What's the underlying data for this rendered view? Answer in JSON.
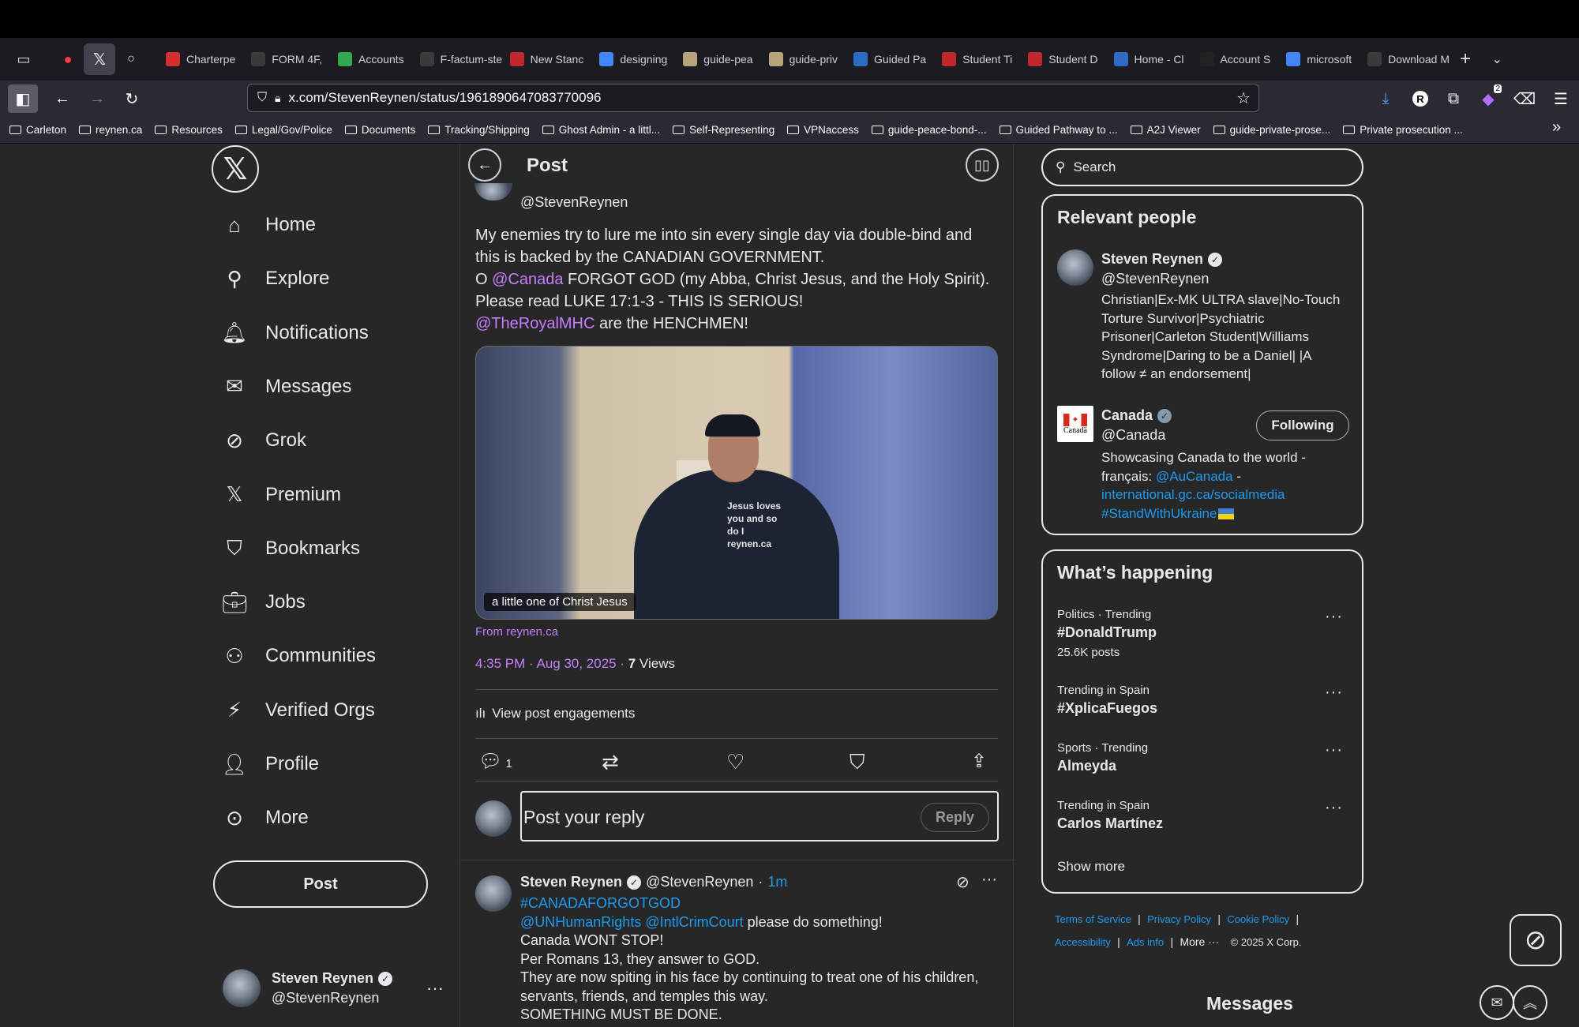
{
  "browser": {
    "tabs": [
      {
        "label": "Charterpe",
        "color": "#d42f2f"
      },
      {
        "label": "FORM 4F,",
        "color": "#3a3a3a"
      },
      {
        "label": "Accounts",
        "color": "#2fa84f"
      },
      {
        "label": "F-factum-stev",
        "color": "#3a3a3a"
      },
      {
        "label": "New Stanc",
        "color": "#c0282d"
      },
      {
        "label": "designing",
        "color": "#4285f4"
      },
      {
        "label": "guide-pea",
        "color": "#b8a47a"
      },
      {
        "label": "guide-priv",
        "color": "#b8a47a"
      },
      {
        "label": "Guided Pa",
        "color": "#2d6cc4"
      },
      {
        "label": "Student Ti",
        "color": "#c0282d"
      },
      {
        "label": "Student D",
        "color": "#c0282d"
      },
      {
        "label": "Home - Cl",
        "color": "#2d6cc4"
      },
      {
        "label": "Account S",
        "color": "#222222"
      },
      {
        "label": "microsoft",
        "color": "#4285f4"
      },
      {
        "label": "Download Mic",
        "color": "#3a3a3a"
      }
    ],
    "url": "x.com/StevenReynen/status/1961890647083770096",
    "bookmarks": [
      "Carleton",
      "reynen.ca",
      "Resources",
      "Legal/Gov/Police",
      "Documents",
      "Tracking/Shipping",
      "Ghost Admin - a littl...",
      "Self-Representing",
      "VPNaccess",
      "guide-peace-bond-...",
      "Guided Pathway to ...",
      "A2J Viewer",
      "guide-private-prose...",
      "Private prosecution ..."
    ],
    "notification_badge": "2"
  },
  "nav": {
    "logo": "𝕏",
    "items": [
      "Home",
      "Explore",
      "Notifications",
      "Messages",
      "Grok",
      "Premium",
      "Bookmarks",
      "Jobs",
      "Communities",
      "Verified Orgs",
      "Profile",
      "More"
    ],
    "post_button": "Post",
    "account_name": "Steven Reynen",
    "account_handle": "@StevenReynen"
  },
  "post": {
    "header_title": "Post",
    "handle": "@StevenReynen",
    "text_line1": "My enemies try to lure me into sin every single day via double-bind and",
    "text_line2": "this is backed by the CANADIAN GOVERNMENT.",
    "text_line3_pre": "O ",
    "text_line3_mention": "@Canada",
    "text_line3_post": " FORGOT GOD (my Abba, Christ Jesus, and the Holy Spirit).",
    "text_line4": "Please read LUKE 17:1-3 - THIS IS SERIOUS!",
    "text_line5_mention": "@TheRoyalMHC",
    "text_line5_post": " are the HENCHMEN!",
    "media_caption": "a little one of Christ Jesus",
    "shirt_text": "Jesus loves you and so do I reynen.ca",
    "source": "From reynen.ca",
    "timestamp": "4:35 PM · Aug 30, 2025 · ",
    "views_count": "7",
    "views_label": " Views",
    "engagements": "View post engagements",
    "reply_count": "1",
    "reply_placeholder": "Post your reply",
    "reply_button": "Reply"
  },
  "reply_post": {
    "name": "Steven Reynen",
    "handle": "@StevenReynen",
    "time": "1m",
    "hashtag": "#CANADAFORGOTGOD",
    "mentions": "@UNHumanRights @IntlCrimCourt",
    "mentions_post": " please do something!",
    "line3": "Canada WONT STOP!",
    "line4": "Per Romans 13, they answer to GOD.",
    "line5": "They are now spiting in his face by continuing to treat one of his children,",
    "line6": "servants, friends, and temples this way.",
    "line7": "SOMETHING MUST BE DONE."
  },
  "sidebar": {
    "search_placeholder": "Search",
    "relevant_title": "Relevant people",
    "people": [
      {
        "name": "Steven Reynen",
        "handle": "@StevenReynen",
        "bio": "Christian|Ex-MK ULTRA slave|No-Touch Torture Survivor|Psychiatric Prisoner|Carleton Student|Williams Syndrome|Daring to be a Daniel| |A follow ≠ an endorsement|"
      },
      {
        "name": "Canada",
        "handle": "@Canada",
        "follow_button": "Following",
        "bio_pre": "Showcasing Canada to the world - français: ",
        "bio_link1": "@AuCanada",
        "bio_mid": " - ",
        "bio_link2": "international.gc.ca/socialmedia",
        "bio_link3": "#StandWithUkraine",
        "logo_text": "Canadä"
      }
    ],
    "happening_title": "What’s happening",
    "trends": [
      {
        "meta": "Politics · Trending",
        "name": "#DonaldTrump",
        "posts": "25.6K posts"
      },
      {
        "meta": "Trending in Spain",
        "name": "#XplicaFuegos",
        "posts": ""
      },
      {
        "meta": "Sports · Trending",
        "name": "Almeyda",
        "posts": ""
      },
      {
        "meta": "Trending in Spain",
        "name": "Carlos Martínez",
        "posts": ""
      }
    ],
    "show_more": "Show more",
    "footer": {
      "terms": "Terms of Service",
      "privacy": "Privacy Policy",
      "cookie": "Cookie Policy",
      "accessibility": "Accessibility",
      "ads": "Ads info",
      "more": "More ···",
      "copyright": "© 2025 X Corp."
    },
    "messages_label": "Messages"
  },
  "colors": {
    "accent_link": "#c77dff",
    "blue": "#1d9bf0",
    "bg": "#272727"
  }
}
